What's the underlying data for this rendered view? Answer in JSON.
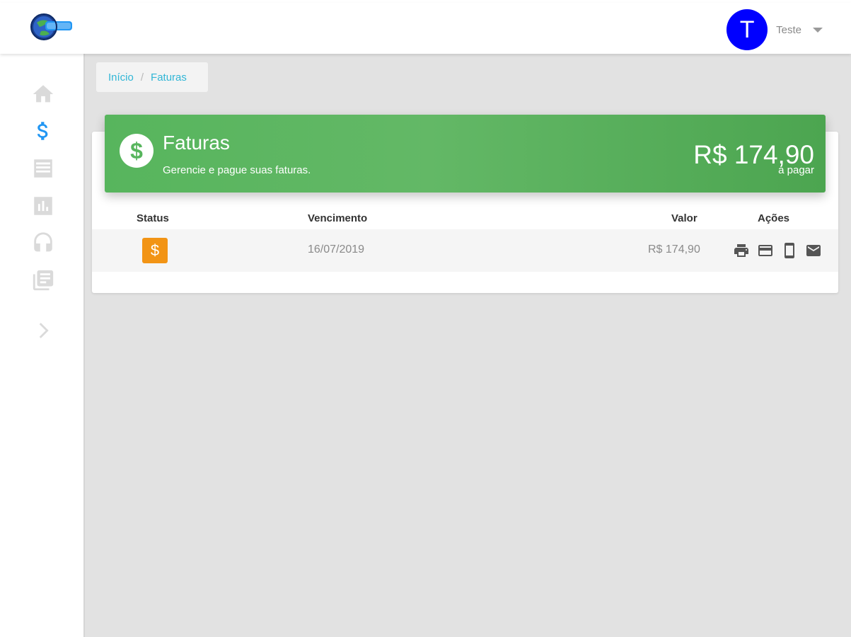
{
  "header": {
    "user_initial": "T",
    "user_name": "Teste",
    "avatar_color": "#0000ff"
  },
  "sidebar": {
    "items": [
      {
        "icon": "home-icon",
        "active": false
      },
      {
        "icon": "dollar-icon",
        "active": true
      },
      {
        "icon": "list-icon",
        "active": false
      },
      {
        "icon": "bar-chart-icon",
        "active": false
      },
      {
        "icon": "headset-icon",
        "active": false
      },
      {
        "icon": "library-books-icon",
        "active": false
      },
      {
        "icon": "chevron-right-icon",
        "active": false
      }
    ],
    "active_color": "#2196f3",
    "inactive_color": "#dadada"
  },
  "breadcrumb": {
    "home": "Início",
    "separator": "/",
    "current": "Faturas"
  },
  "banner": {
    "title": "Faturas",
    "subtitle": "Gerencie e pague suas faturas.",
    "amount": "R$ 174,90",
    "amount_label": "a pagar",
    "color": "#57b55d"
  },
  "table": {
    "headers": {
      "status": "Status",
      "due": "Vencimento",
      "value": "Valor",
      "actions": "Ações"
    },
    "rows": [
      {
        "status_symbol": "$",
        "due": "16/07/2019",
        "value": "R$ 174,90"
      }
    ],
    "status_color": "#f29415"
  },
  "actions": [
    "print-icon",
    "credit-card-icon",
    "smartphone-icon",
    "email-icon"
  ]
}
